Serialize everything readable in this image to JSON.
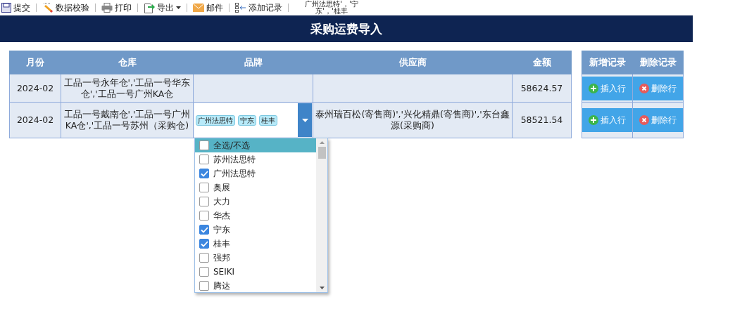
{
  "toolbar": {
    "items": [
      {
        "label": "提交"
      },
      {
        "label": "数据校验"
      },
      {
        "label": "打印"
      },
      {
        "label": "导出",
        "has_menu": true
      },
      {
        "label": "邮件"
      },
      {
        "label": "添加记录"
      }
    ],
    "overflow_text": "广州法思特'，'宁东'，'桂丰"
  },
  "title": "采购运费导入",
  "table": {
    "columns": [
      "月份",
      "仓库",
      "品牌",
      "供应商",
      "金额"
    ],
    "rows": [
      {
        "month": "2024-02",
        "warehouse": "工品一号永年仓','工品一号华东仓','工品一号广州KA仓",
        "supplier": "",
        "amount": "58624.57"
      },
      {
        "month": "2024-02",
        "warehouse": "工品一号戴南仓','工品一号广州KA仓','工品一号苏州（采购仓)",
        "brand_select": {
          "tags": [
            "广州法思特",
            "宁东",
            "桂丰"
          ],
          "expanded": true,
          "options": [
            {
              "label": "全选/不选",
              "checked": false,
              "highlighted": true
            },
            {
              "label": "苏州法思特",
              "checked": false,
              "highlighted": false
            },
            {
              "label": "广州法思特",
              "checked": true,
              "highlighted": false
            },
            {
              "label": "奥展",
              "checked": false,
              "highlighted": false
            },
            {
              "label": "大力",
              "checked": false,
              "highlighted": false
            },
            {
              "label": "华杰",
              "checked": false,
              "highlighted": false
            },
            {
              "label": "宁东",
              "checked": true,
              "highlighted": false
            },
            {
              "label": "桂丰",
              "checked": true,
              "highlighted": false
            },
            {
              "label": "强邦",
              "checked": false,
              "highlighted": false
            },
            {
              "label": "SEIKI",
              "checked": false,
              "highlighted": false
            },
            {
              "label": "腾达",
              "checked": false,
              "highlighted": false
            }
          ]
        },
        "supplier": "泰州瑞百松(寄售商)','兴化精鼎(寄售商)','东台鑫源(采购商)",
        "amount": "58521.54"
      }
    ]
  },
  "actions": {
    "columns": [
      "新增记录",
      "删除记录"
    ],
    "rows": [
      {
        "insert": "插入行",
        "delete": "删除行"
      },
      {
        "insert": "插入行",
        "delete": "删除行"
      }
    ]
  }
}
